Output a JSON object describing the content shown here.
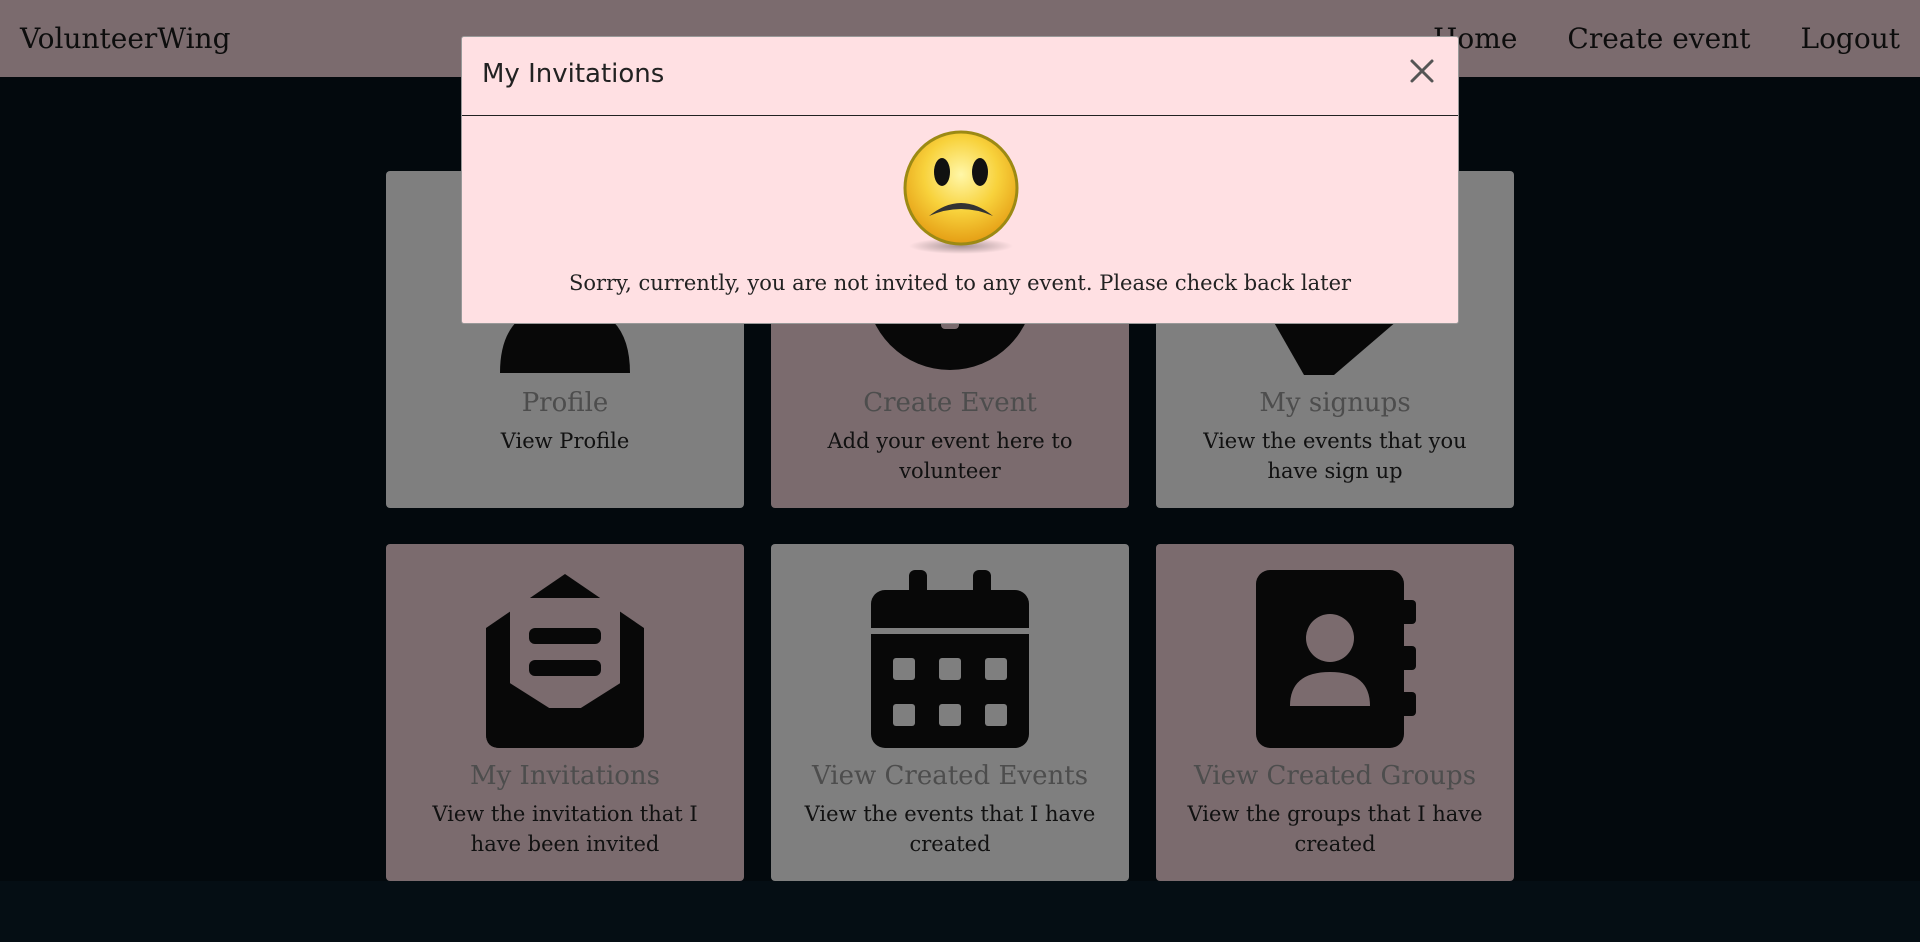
{
  "navbar": {
    "brand": "VolunteerWing",
    "links": [
      "Home",
      "Create event",
      "Logout"
    ]
  },
  "cards": [
    {
      "title": "Profile",
      "description": "View Profile",
      "icon": "user-icon"
    },
    {
      "title": "Create Event",
      "description": "Add your event here to volunteer",
      "icon": "plus-circle-icon"
    },
    {
      "title": "My signups",
      "description": "View the events that you have sign up",
      "icon": "tag-icon"
    },
    {
      "title": "My Invitations",
      "description": "View the invitation that I have been invited",
      "icon": "envelope-open-icon"
    },
    {
      "title": "View Created Events",
      "description": "View the events that I have created",
      "icon": "calendar-icon"
    },
    {
      "title": "View Created Groups",
      "description": "View the groups that I have created",
      "icon": "address-book-icon"
    }
  ],
  "modal": {
    "title": "My Invitations",
    "close_icon": "close-icon",
    "illustration": "sad-face-icon",
    "message": "Sorry, currently, you are not invited to any event. Please check back later"
  }
}
